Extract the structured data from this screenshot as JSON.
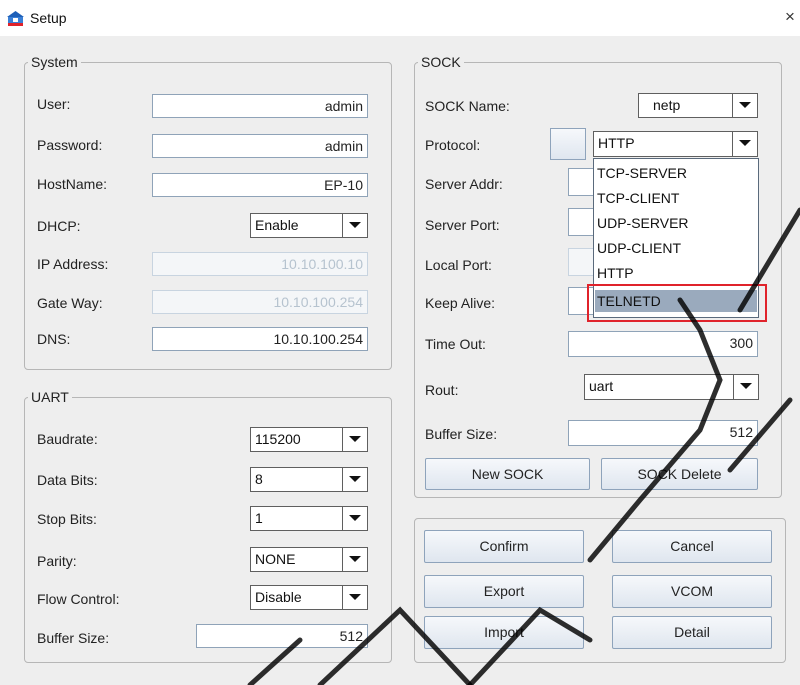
{
  "window": {
    "title": "Setup",
    "icon": "setup-app-icon",
    "close_glyph": "×"
  },
  "system": {
    "legend": "System",
    "user": {
      "label": "User:",
      "value": "admin"
    },
    "password": {
      "label": "Password:",
      "value": "admin"
    },
    "hostname": {
      "label": "HostName:",
      "value": "EP-10"
    },
    "dhcp": {
      "label": "DHCP:",
      "value": "Enable"
    },
    "ip": {
      "label": "IP Address:",
      "value": "10.10.100.10"
    },
    "gateway": {
      "label": "Gate Way:",
      "value": "10.10.100.254"
    },
    "dns": {
      "label": "DNS:",
      "value": "10.10.100.254"
    }
  },
  "uart": {
    "legend": "UART",
    "baudrate": {
      "label": "Baudrate:",
      "value": "115200"
    },
    "databits": {
      "label": "Data Bits:",
      "value": "8"
    },
    "stopbits": {
      "label": "Stop Bits:",
      "value": "1"
    },
    "parity": {
      "label": "Parity:",
      "value": "NONE"
    },
    "flow": {
      "label": "Flow Control:",
      "value": "Disable"
    },
    "buffer": {
      "label": "Buffer Size:",
      "value": "512"
    }
  },
  "sock": {
    "legend": "SOCK",
    "name": {
      "label": "SOCK Name:",
      "value": "netp"
    },
    "protocol": {
      "label": "Protocol:",
      "value": "HTTP",
      "options": [
        "TCP-SERVER",
        "TCP-CLIENT",
        "UDP-SERVER",
        "UDP-CLIENT",
        "HTTP",
        "TELNETD"
      ],
      "selected_option": "TELNETD"
    },
    "server_addr": {
      "label": "Server Addr:"
    },
    "server_port": {
      "label": "Server Port:"
    },
    "local_port": {
      "label": "Local Port:"
    },
    "keep_alive": {
      "label": "Keep Alive:"
    },
    "timeout": {
      "label": "Time Out:",
      "value": "300"
    },
    "rout": {
      "label": "Rout:",
      "value": "uart"
    },
    "buffer": {
      "label": "Buffer Size:",
      "value": "512"
    },
    "new_button": "New SOCK",
    "delete_button": "SOCK Delete"
  },
  "actions": {
    "confirm": "Confirm",
    "cancel": "Cancel",
    "export": "Export",
    "vcom": "VCOM",
    "import": "Import",
    "detail": "Detail"
  },
  "colors": {
    "highlight": "#e0232b",
    "selected_option": "#9aaabd",
    "field_border": "#8fa3b8"
  }
}
